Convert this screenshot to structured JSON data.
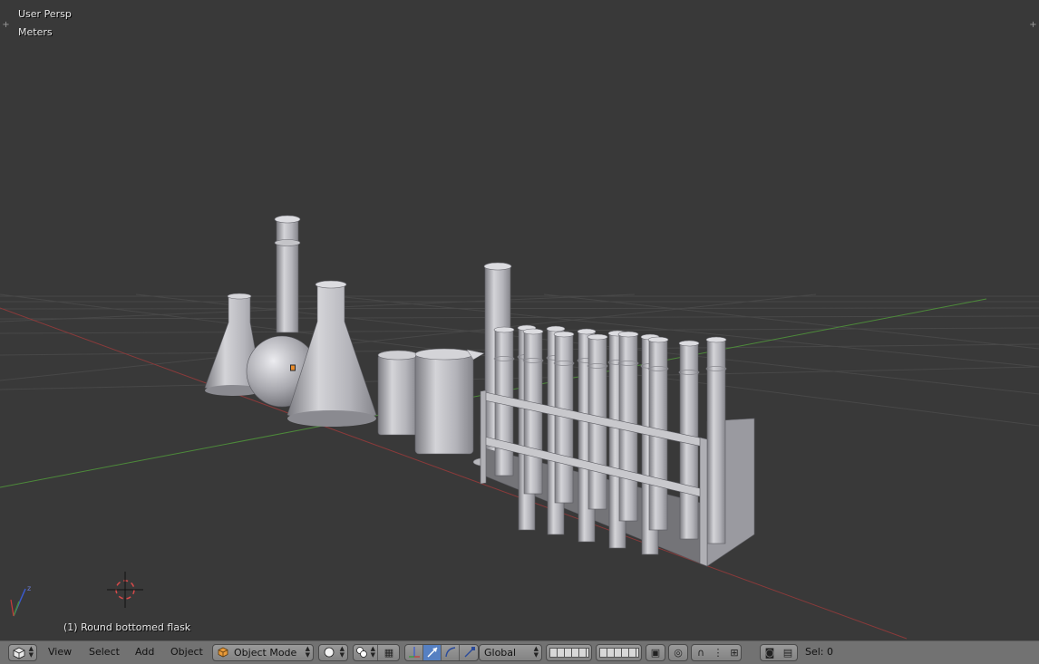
{
  "viewport": {
    "view_name": "User Persp",
    "units": "Meters",
    "active_object": "(1) Round bottomed flask"
  },
  "header": {
    "menus": [
      "View",
      "Select",
      "Add",
      "Object"
    ],
    "mode": "Object Mode",
    "transform_orientation": "Global",
    "selection_count": "Sel: 0"
  },
  "colors": {
    "background": "#393939",
    "grid": "#4a4a4a",
    "x_axis": "#8a3a3a",
    "y_axis": "#4d8a3a",
    "header": "#727272",
    "active_manipulator": "#5680c2"
  }
}
